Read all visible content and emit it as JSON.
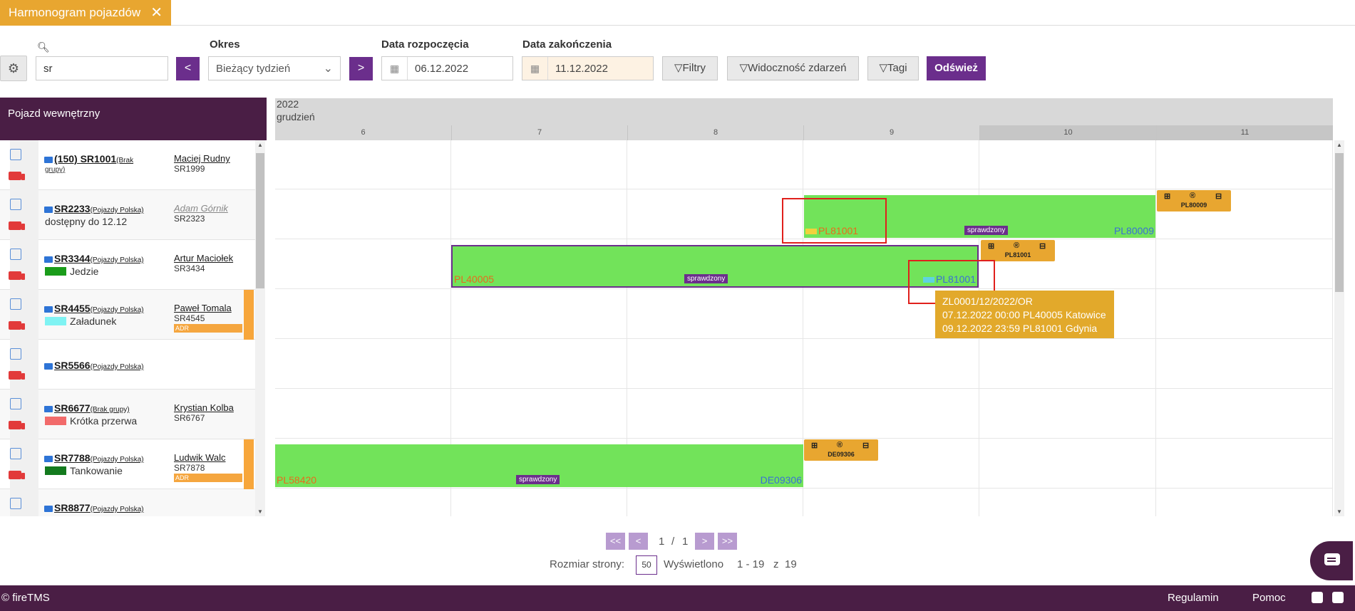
{
  "tab": {
    "title": "Harmonogram pojazdów",
    "close": "✕"
  },
  "toolbar": {
    "search_value": "sr",
    "okres_label": "Okres",
    "okres_value": "Bieżący tydzień",
    "prev": "<",
    "next": ">",
    "start_label": "Data rozpoczęcia",
    "start_value": "06.12.2022",
    "end_label": "Data zakończenia",
    "end_value": "11.12.2022",
    "filters": "▽Filtry",
    "visibility": "▽Widoczność zdarzeń",
    "tags": "▽Tagi",
    "refresh": "Odśwież"
  },
  "left": {
    "header": "Pojazd wewnętrzny",
    "vehicles": [
      {
        "name": "(150) SR1001",
        "group": "(Brak",
        "group2": "grupy)",
        "status": "",
        "driver": "Maciej Rudny",
        "plate2": "SR1999",
        "adr": ""
      },
      {
        "name": "SR2233",
        "group": "(Pojazdy Polska)",
        "status": "dostępny do 12.12",
        "driver": "Adam Górnik",
        "plate2": "SR2323",
        "adr": ""
      },
      {
        "name": "SR3344",
        "group": "(Pojazdy Polska)",
        "status": "Jedzie",
        "driver": "Artur Maciołek",
        "plate2": "SR3434",
        "adr": ""
      },
      {
        "name": "SR4455",
        "group": "(Pojazdy Polska)",
        "status": "Załadunek",
        "driver": "Paweł Tomala",
        "plate2": "SR4545",
        "adr": "ADR"
      },
      {
        "name": "SR5566",
        "group": "(Pojazdy Polska)",
        "status": "",
        "driver": "",
        "plate2": "",
        "adr": ""
      },
      {
        "name": "SR6677",
        "group": "(Brak grupy)",
        "status": "Krótka przerwa",
        "driver": "Krystian Kolba",
        "plate2": "SR6767",
        "adr": ""
      },
      {
        "name": "SR7788",
        "group": "(Pojazdy Polska)",
        "status": "Tankowanie",
        "driver": "Ludwik Walc",
        "plate2": "SR7878",
        "adr": "ADR"
      },
      {
        "name": "SR8877",
        "group": "(Pojazdy Polska)",
        "status": "",
        "driver": "",
        "plate2": "",
        "adr": ""
      }
    ]
  },
  "gantt": {
    "year": "2022",
    "month": "grudzień",
    "days": [
      "6",
      "7",
      "8",
      "9",
      "10",
      "11"
    ],
    "verified": "sprawdzony",
    "bars": [
      {
        "from": "PL81001",
        "to": "PL80009"
      },
      {
        "from": "PL40005",
        "to": "PL81001"
      },
      {
        "from": "PL58420",
        "to": "DE09306"
      }
    ],
    "events": [
      "PL80009",
      "PL81001",
      "DE09306"
    ],
    "tooltip": [
      "ZL0001/12/2022/OR",
      "07.12.2022 00:00 PL40005 Katowice",
      "09.12.2022 23:59 PL81001 Gdynia"
    ]
  },
  "pager": {
    "first": "<<",
    "prev": "<",
    "page": "1",
    "sep": "/",
    "total": "1",
    "next": ">",
    "last": ">>",
    "size_label": "Rozmiar strony:",
    "size": "50",
    "shown_label": "Wyświetlono",
    "shown": "1 - 19",
    "of": "z",
    "count": "19"
  },
  "footer": {
    "brand": "© fireTMS",
    "terms": "Regulamin",
    "help": "Pomoc"
  },
  "colors": {
    "accent": "#6b2e8c",
    "brand": "#4a1e45",
    "tab": "#e8a630",
    "bar": "#72e35a"
  }
}
